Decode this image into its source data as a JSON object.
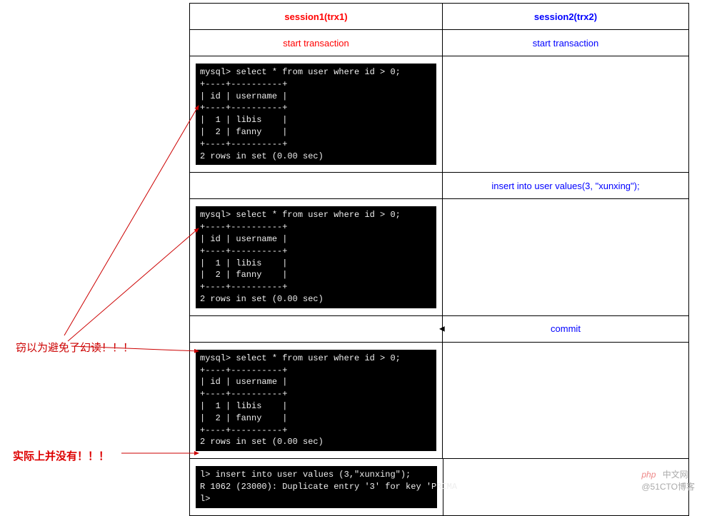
{
  "left": {
    "note1": "窃以为避免了幻读！！！",
    "note2": "实际上并没有！！！"
  },
  "headers": {
    "col1": "session1(trx1)",
    "col2": "session2(trx2)"
  },
  "rows": [
    {
      "c1_text": "start transaction",
      "c1_class": "red-text",
      "c2_text": "start transaction",
      "c2_class": "blue-text"
    },
    {
      "c1_code": "mysql> select * from user where id > 0;\n+----+----------+\n| id | username |\n+----+----------+\n|  1 | libis    |\n|  2 | fanny    |\n+----+----------+\n2 rows in set (0.00 sec)",
      "c2_text": ""
    },
    {
      "c1_text": "",
      "c2_text": "insert into user values(3, \"xunxing\");",
      "c2_class": "blue-text"
    },
    {
      "c1_code": "mysql> select * from user where id > 0;\n+----+----------+\n| id | username |\n+----+----------+\n|  1 | libis    |\n|  2 | fanny    |\n+----+----------+\n2 rows in set (0.00 sec)",
      "c2_text": ""
    },
    {
      "c1_text": "",
      "c2_text": "commit",
      "c2_class": "blue-text",
      "c2_arrow": true
    },
    {
      "c1_code": "mysql> select * from user where id > 0;\n+----+----------+\n| id | username |\n+----+----------+\n|  1 | libis    |\n|  2 | fanny    |\n+----+----------+\n2 rows in set (0.00 sec)",
      "c2_text": ""
    },
    {
      "c1_code": "l> insert into user values (3,\"xunxing\");\nR 1062 (23000): Duplicate entry '3' for key 'PRIMA\nl>",
      "c2_text": ""
    }
  ],
  "watermark": {
    "php": "php",
    "cn": "中文网",
    "cto": "@51CTO博客"
  }
}
